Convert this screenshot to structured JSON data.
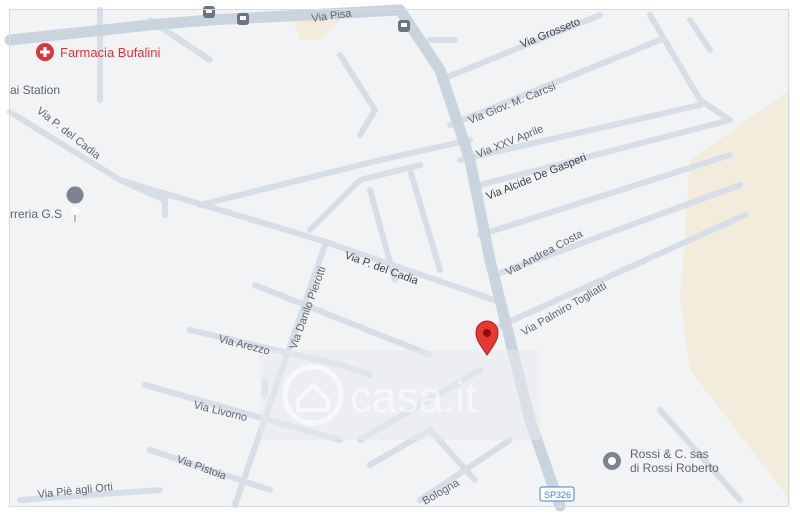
{
  "streets": {
    "via_pisa": "Via Pisa",
    "via_grosseto": "Via Grosseto",
    "via_giov_carcsi": "Via Giov. M. Carcsi",
    "via_xxv_aprile": "Via XXV Aprile",
    "via_alcide": "Via Alcide De Gasperi",
    "via_p_del_cadia_1": "Via P. del Cadia",
    "via_p_del_cadia_2": "Via P. del Cadia",
    "via_andrea_costa": "Via Andrea Costa",
    "via_palmiro": "Via Palmiro Togliatti",
    "via_danilo": "Via Danilo Pierotti",
    "via_arezzo": "Via Arezzo",
    "via_livorno": "Via Livorno",
    "via_pistoia": "Via Pistoia",
    "via_bologna": "Bologna",
    "via_pie": "Via Piè agli Orti"
  },
  "pois": {
    "farmacia": "Farmacia Bufalini",
    "station": "ai Station",
    "ferreria": "rreria G.S",
    "rossi_line1": "Rossi & C. sas",
    "rossi_line2": "di Rossi Roberto"
  },
  "route_badge": "SP326",
  "watermark": "casa.it",
  "colors": {
    "background": "#f2f3f5",
    "road": "#d6dfe8",
    "main_road": "#c9d4de",
    "park": "#f3ecdc",
    "pin": "#e53935",
    "poi_red": "#d9363f"
  }
}
